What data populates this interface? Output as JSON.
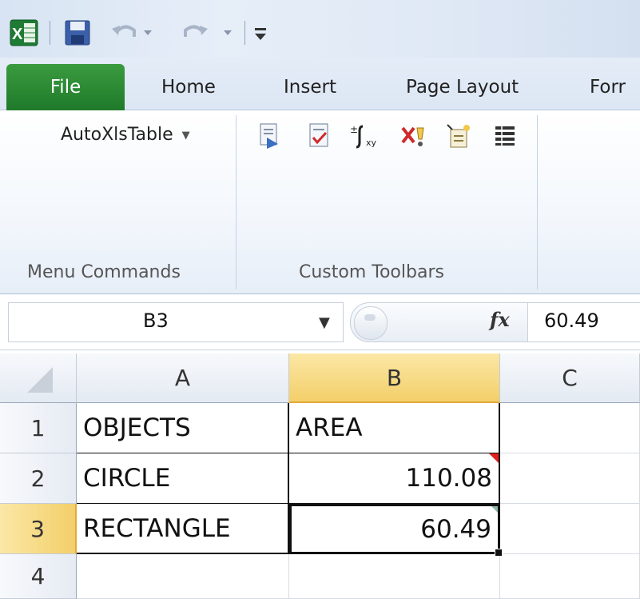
{
  "quick_access": {
    "icons": [
      "excel-logo-icon",
      "save-icon",
      "undo-icon",
      "redo-icon",
      "customize-qat-icon"
    ]
  },
  "tabs": {
    "file": "File",
    "home": "Home",
    "insert": "Insert",
    "page_layout": "Page Layout",
    "formulas_partial": "Forr"
  },
  "ribbon": {
    "menu_commands": {
      "dropdown_label": "AutoXlsTable",
      "group_label": "Menu Commands"
    },
    "custom_toolbars": {
      "group_label": "Custom Toolbars",
      "icons": [
        "edit-document-icon",
        "checklist-icon",
        "formula-xy-icon",
        "delete-rule-icon",
        "wizard-icon",
        "table-list-icon"
      ]
    }
  },
  "formula_bar": {
    "name_box": "B3",
    "fx_symbol": "fx",
    "value": "60.49"
  },
  "sheet": {
    "columns": [
      "A",
      "B",
      "C"
    ],
    "selected_column": "B",
    "selected_row": "3",
    "rows": [
      {
        "num": "1",
        "A": "OBJECTS",
        "B": "AREA"
      },
      {
        "num": "2",
        "A": "CIRCLE",
        "B": "110.08"
      },
      {
        "num": "3",
        "A": "RECTANGLE",
        "B": "60.49"
      },
      {
        "num": "4",
        "A": "",
        "B": ""
      }
    ]
  },
  "colors": {
    "file_tab": "#1f7a2a",
    "selected_header": "#f7d77a",
    "comment_marker": "#e02020"
  }
}
